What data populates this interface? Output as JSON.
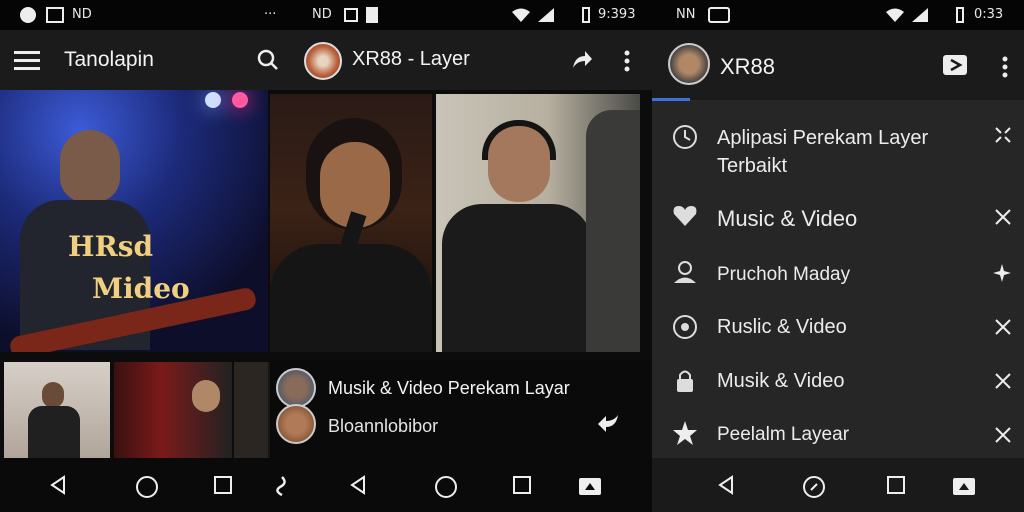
{
  "status": {
    "left_text": "ND",
    "center_icons": "···",
    "mid_text": "ND",
    "time_middle": "9:393",
    "right_left_text": "NN",
    "time_right": "0:33"
  },
  "left_appbar": {
    "title": "Tanolapin"
  },
  "center_appbar": {
    "title": "XR88 - Layer"
  },
  "drawer": {
    "header_title": "XR88",
    "items": [
      {
        "label": "Aplipasi Perekam Layer Terbaikt",
        "icon": "clock-icon",
        "action": "expand-icon"
      },
      {
        "label": "Music & Video",
        "icon": "heart-icon",
        "action": "close-icon"
      },
      {
        "label": "Pruchoh Maday",
        "icon": "person-icon",
        "action": "sparkle-icon"
      },
      {
        "label": "Ruslic & Video",
        "icon": "disc-icon",
        "action": "close-icon"
      },
      {
        "label": "Musik & Video",
        "icon": "lock-icon",
        "action": "close-icon"
      },
      {
        "label": "Peelalm Layear",
        "icon": "star-icon",
        "action": "close-icon"
      }
    ]
  },
  "hero": {
    "overlay_line1": "HRsd",
    "overlay_line2": "Mideo"
  },
  "overlay": {
    "line1": "Musik & Video Perekam Layar",
    "line2": "Bloannlobibor"
  },
  "colors": {
    "accent": "#3f6fd8",
    "drawer_bg": "#262626",
    "appbar_bg": "#1b1b1b"
  }
}
